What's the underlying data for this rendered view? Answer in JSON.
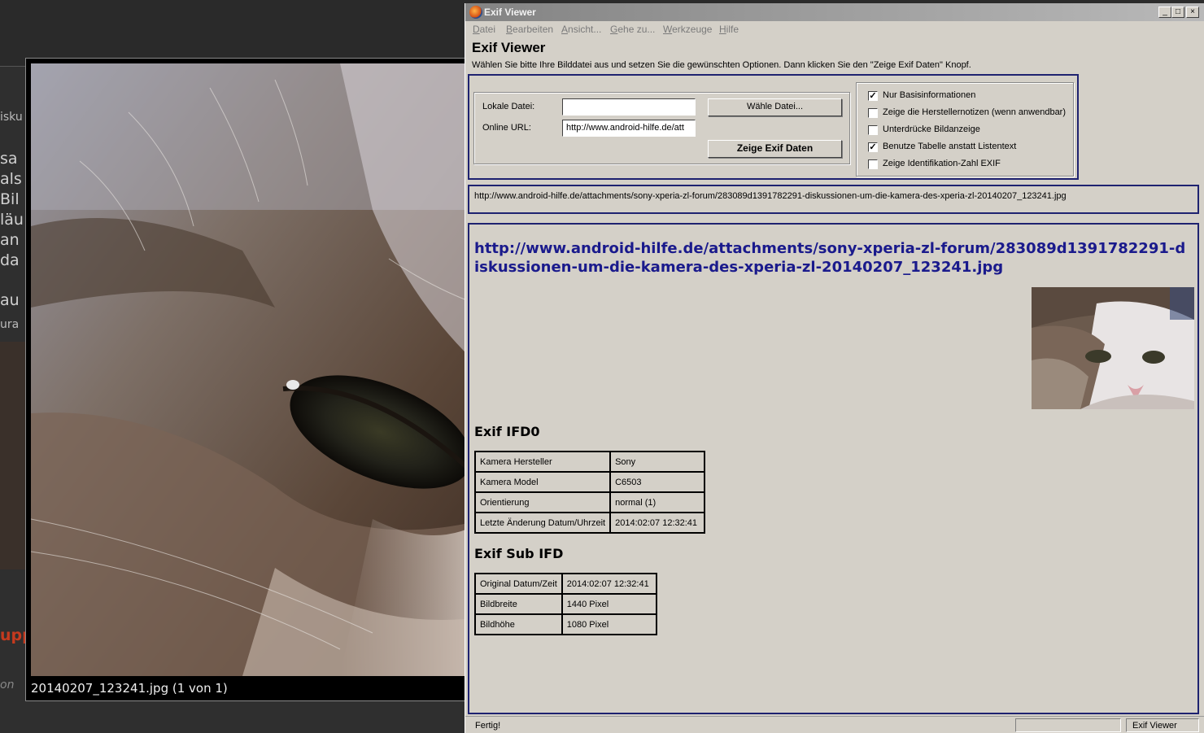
{
  "background": {
    "fragments": [
      "isku",
      "sa",
      "als",
      "Bil",
      "läu",
      "an",
      "da",
      "au",
      "ura",
      "upp",
      "on"
    ]
  },
  "viewer": {
    "caption": "20140207_123241.jpg (1 von 1)"
  },
  "window": {
    "title": "Exif Viewer",
    "controls": [
      "_",
      "□",
      "×"
    ],
    "menu": [
      "Datei",
      "Bearbeiten",
      "Ansicht...",
      "Gehe zu...",
      "Werkzeuge",
      "Hilfe"
    ],
    "heading": "Exif Viewer",
    "description": "Wählen Sie bitte Ihre Bilddatei aus und setzen Sie die gewünschten Optionen. Dann klicken Sie den \"Zeige Exif Daten\" Knopf.",
    "form": {
      "local_label": "Lokale Datei:",
      "local_value": "",
      "online_label": "Online URL:",
      "online_value": "http://www.android-hilfe.de/att",
      "choose_button": "Wähle Datei...",
      "show_button": "Zeige Exif Daten"
    },
    "options": [
      {
        "label": "Nur Basisinformationen",
        "checked": true
      },
      {
        "label": "Zeige die Herstellernotizen (wenn anwendbar)",
        "checked": false
      },
      {
        "label": "Unterdrücke Bildanzeige",
        "checked": false
      },
      {
        "label": "Benutze Tabelle anstatt Listentext",
        "checked": true
      },
      {
        "label": "Zeige Identifikation-Zahl EXIF",
        "checked": false
      }
    ],
    "url_line": "http://www.android-hilfe.de/attachments/sony-xperia-zl-forum/283089d1391782291-diskussionen-um-die-kamera-des-xperia-zl-20140207_123241.jpg",
    "result": {
      "url_title": "http://www.android-hilfe.de/attachments/sony-xperia-zl-forum/283089d1391782291-diskussionen-um-die-kamera-des-xperia-zl-20140207_123241.jpg",
      "ifd0_heading": "Exif IFD0",
      "ifd0_rows": [
        [
          "Kamera Hersteller",
          "Sony"
        ],
        [
          "Kamera Model",
          "C6503"
        ],
        [
          "Orientierung",
          "normal (1)"
        ],
        [
          "Letzte Änderung Datum/Uhrzeit",
          "2014:02:07 12:32:41"
        ]
      ],
      "sub_heading": "Exif Sub IFD",
      "sub_rows": [
        [
          "Original Datum/Zeit",
          "2014:02:07 12:32:41"
        ],
        [
          "Bildbreite",
          "1440 Pixel"
        ],
        [
          "Bildhöhe",
          "1080 Pixel"
        ]
      ]
    },
    "status": {
      "left": "Fertig!",
      "right": "Exif Viewer"
    }
  },
  "colors": {
    "window_bg": "#d4d0c8",
    "navy_border": "#1e2270",
    "link_blue": "#1a1a8c"
  }
}
